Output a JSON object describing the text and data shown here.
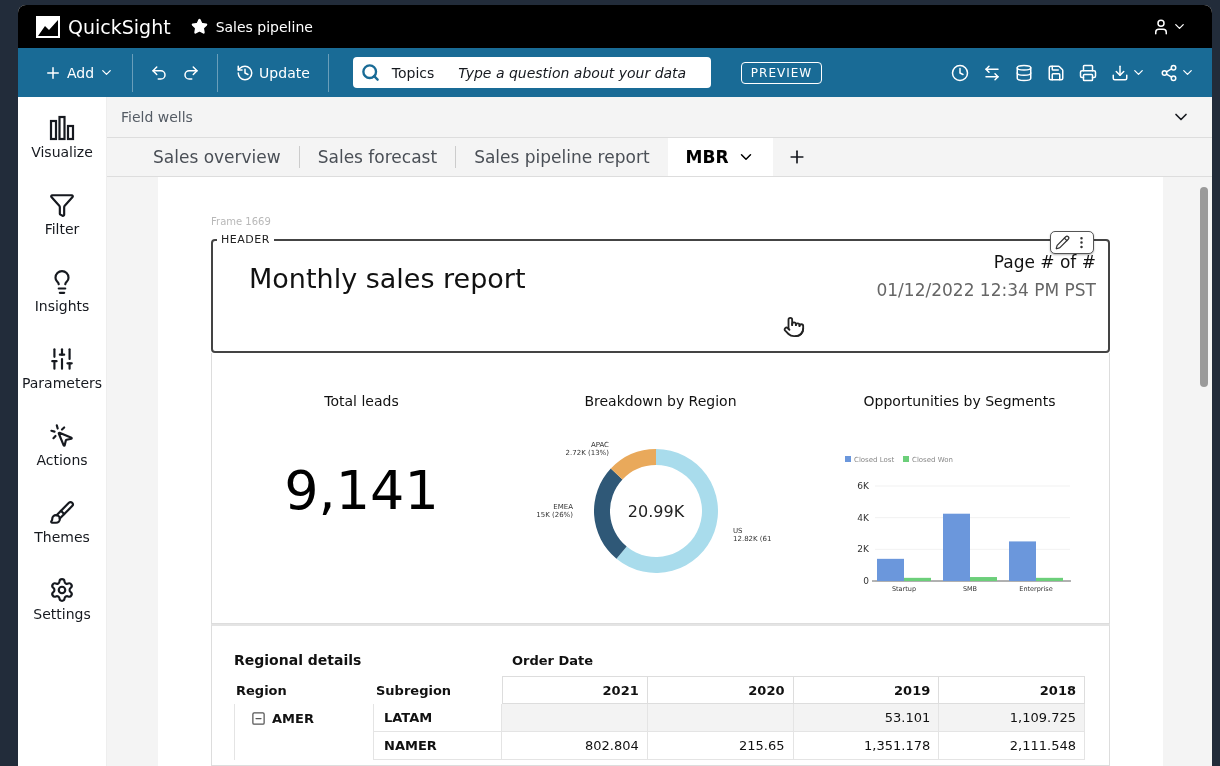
{
  "app": {
    "name": "QuickSight",
    "analysis": "Sales pipeline",
    "favorite": true
  },
  "toolbar": {
    "add": "Add",
    "update": "Update",
    "topics": "Topics",
    "question_placeholder": "Type a question about your data",
    "preview": "PREVIEW"
  },
  "sidebar": {
    "items": [
      {
        "label": "Visualize",
        "kind": "chart"
      },
      {
        "label": "Filter",
        "kind": "filter"
      },
      {
        "label": "Insights",
        "kind": "bulb"
      },
      {
        "label": "Parameters",
        "kind": "sliders"
      },
      {
        "label": "Actions",
        "kind": "pointer"
      },
      {
        "label": "Themes",
        "kind": "brush"
      },
      {
        "label": "Settings",
        "kind": "gear"
      }
    ]
  },
  "field_wells": {
    "label": "Field wells",
    "expanded": false
  },
  "sheet_tabs": [
    {
      "label": "Sales overview",
      "selected": false
    },
    {
      "label": "Sales forecast",
      "selected": false
    },
    {
      "label": "Sales pipeline report",
      "selected": false
    },
    {
      "label": "MBR",
      "selected": true
    }
  ],
  "frame_label": "Frame 1669",
  "header": {
    "legend": "HEADER",
    "title": "Monthly sales report",
    "page": "Page # of #",
    "timestamp": "01/12/2022 12:34 PM PST"
  },
  "kpi": {
    "title": "Total leads",
    "value": "9,141"
  },
  "donut": {
    "title": "Breakdown by Region",
    "center": "20.99K",
    "chart_data": {
      "type": "donut",
      "categories": [
        "US",
        "EMEA",
        "APAC"
      ],
      "values": [
        61,
        26,
        13
      ],
      "colors": [
        "#a9dcec",
        "#2f5877",
        "#e9a95b"
      ],
      "value_labels": [
        "12.82K (61",
        "15K (26%)",
        "2.72K (13%)"
      ]
    }
  },
  "bars": {
    "title": "Opportunities by Segments",
    "chart_data": {
      "type": "bar",
      "categories": [
        "Startup",
        "SMB",
        "Enterprise"
      ],
      "series": [
        {
          "name": "Closed Lost",
          "color": "#6b97dc",
          "values": [
            1400,
            4250,
            2500
          ]
        },
        {
          "name": "Closed Won",
          "color": "#6ccf7a",
          "values": [
            200,
            250,
            200
          ]
        }
      ],
      "legend": "top",
      "ylim": [
        0,
        6000
      ],
      "yticks": [
        {
          "value": 0,
          "label": "0"
        },
        {
          "value": 2000,
          "label": "2K"
        },
        {
          "value": 4000,
          "label": "4K"
        },
        {
          "value": 6000,
          "label": "6K"
        }
      ]
    }
  },
  "table": {
    "title": "Regional details",
    "group_header": "Order Date",
    "columns": [
      "Region",
      "Subregion",
      "2021",
      "2020",
      "2019",
      "2018"
    ],
    "rows": [
      {
        "expanded": true,
        "cells": [
          "AMER",
          "LATAM",
          "",
          "",
          "53.101",
          "1,109.725"
        ]
      },
      {
        "cells": [
          "",
          "NAMER",
          "802.804",
          "215.65",
          "1,351.178",
          "2,111.548"
        ]
      }
    ]
  }
}
